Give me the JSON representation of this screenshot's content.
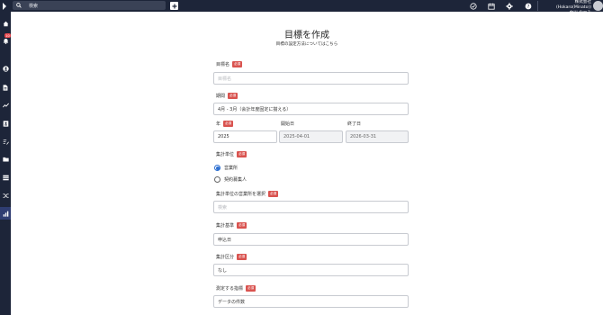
{
  "header": {
    "search_placeholder": "検索",
    "company_line1": "株式会社(Hokaro(Minato))",
    "company_line2": "中川 なつみ",
    "icons": [
      "check-circle-icon",
      "calendar-icon",
      "gear-icon",
      "help-icon"
    ]
  },
  "sidebar": {
    "notification_count": "10"
  },
  "page": {
    "title": "目標を作成",
    "help_link": "目標の設定方法についてはこちら"
  },
  "required_label": "必須",
  "form": {
    "goal_name": {
      "label": "目標名",
      "placeholder": "目標名"
    },
    "period": {
      "label": "期間",
      "value": "4月 - 3月（会計年度固定に揃える）"
    },
    "year": {
      "label": "年",
      "value": "2025"
    },
    "start_date": {
      "label": "開始日",
      "value": "2025-04-01"
    },
    "end_date": {
      "label": "終了日",
      "value": "2026-03-31"
    },
    "unit": {
      "label": "集計単位",
      "options": [
        "営業所",
        "契約募集人"
      ],
      "selected": 0
    },
    "office_select": {
      "label": "集計単位の営業所を選択",
      "placeholder": "検索"
    },
    "basis": {
      "label": "集計基準",
      "value": "申込日"
    },
    "category": {
      "label": "集計区分",
      "value": "なし"
    },
    "metric": {
      "label": "測定する指標",
      "value": "データの件数"
    }
  }
}
